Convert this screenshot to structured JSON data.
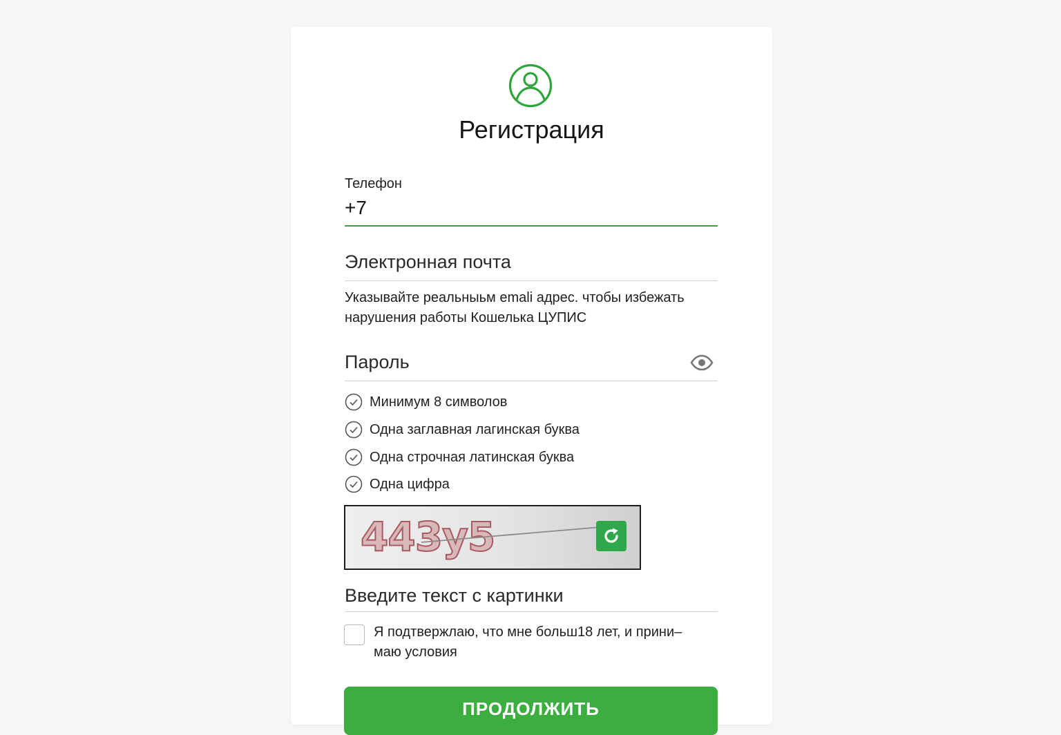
{
  "header": {
    "title": "Регистрация",
    "icon": "user-icon"
  },
  "phone": {
    "label": "Телефон",
    "value": "+7"
  },
  "email": {
    "placeholder": "Электронная почта",
    "hint_line1": "Указывайте реальныьм emali адрес. чтобы избежать",
    "hint_line2": "нарушения работы Кошелька ЦУПИС"
  },
  "password": {
    "placeholder": "Пароль",
    "toggle_icon": "eye-icon",
    "requirements": [
      "Минимум 8 символов",
      "Одна заглавная лагинская буква",
      "Одна строчная латинская буква",
      "Одна цифра"
    ]
  },
  "captcha": {
    "text": "443y5",
    "refresh_icon": "refresh-icon"
  },
  "captcha_input": {
    "placeholder": "Введите текст с картинки"
  },
  "agreement": {
    "line1": "Я подтвержлаю, что мне больш18 лет, и прини–",
    "line2": "маю условия"
  },
  "submit": {
    "label": "ПРОДОЛЖИТЬ"
  },
  "colors": {
    "accent": "#3cae3f",
    "icon_green": "#2ea43a",
    "line": "#d0d0d0"
  }
}
